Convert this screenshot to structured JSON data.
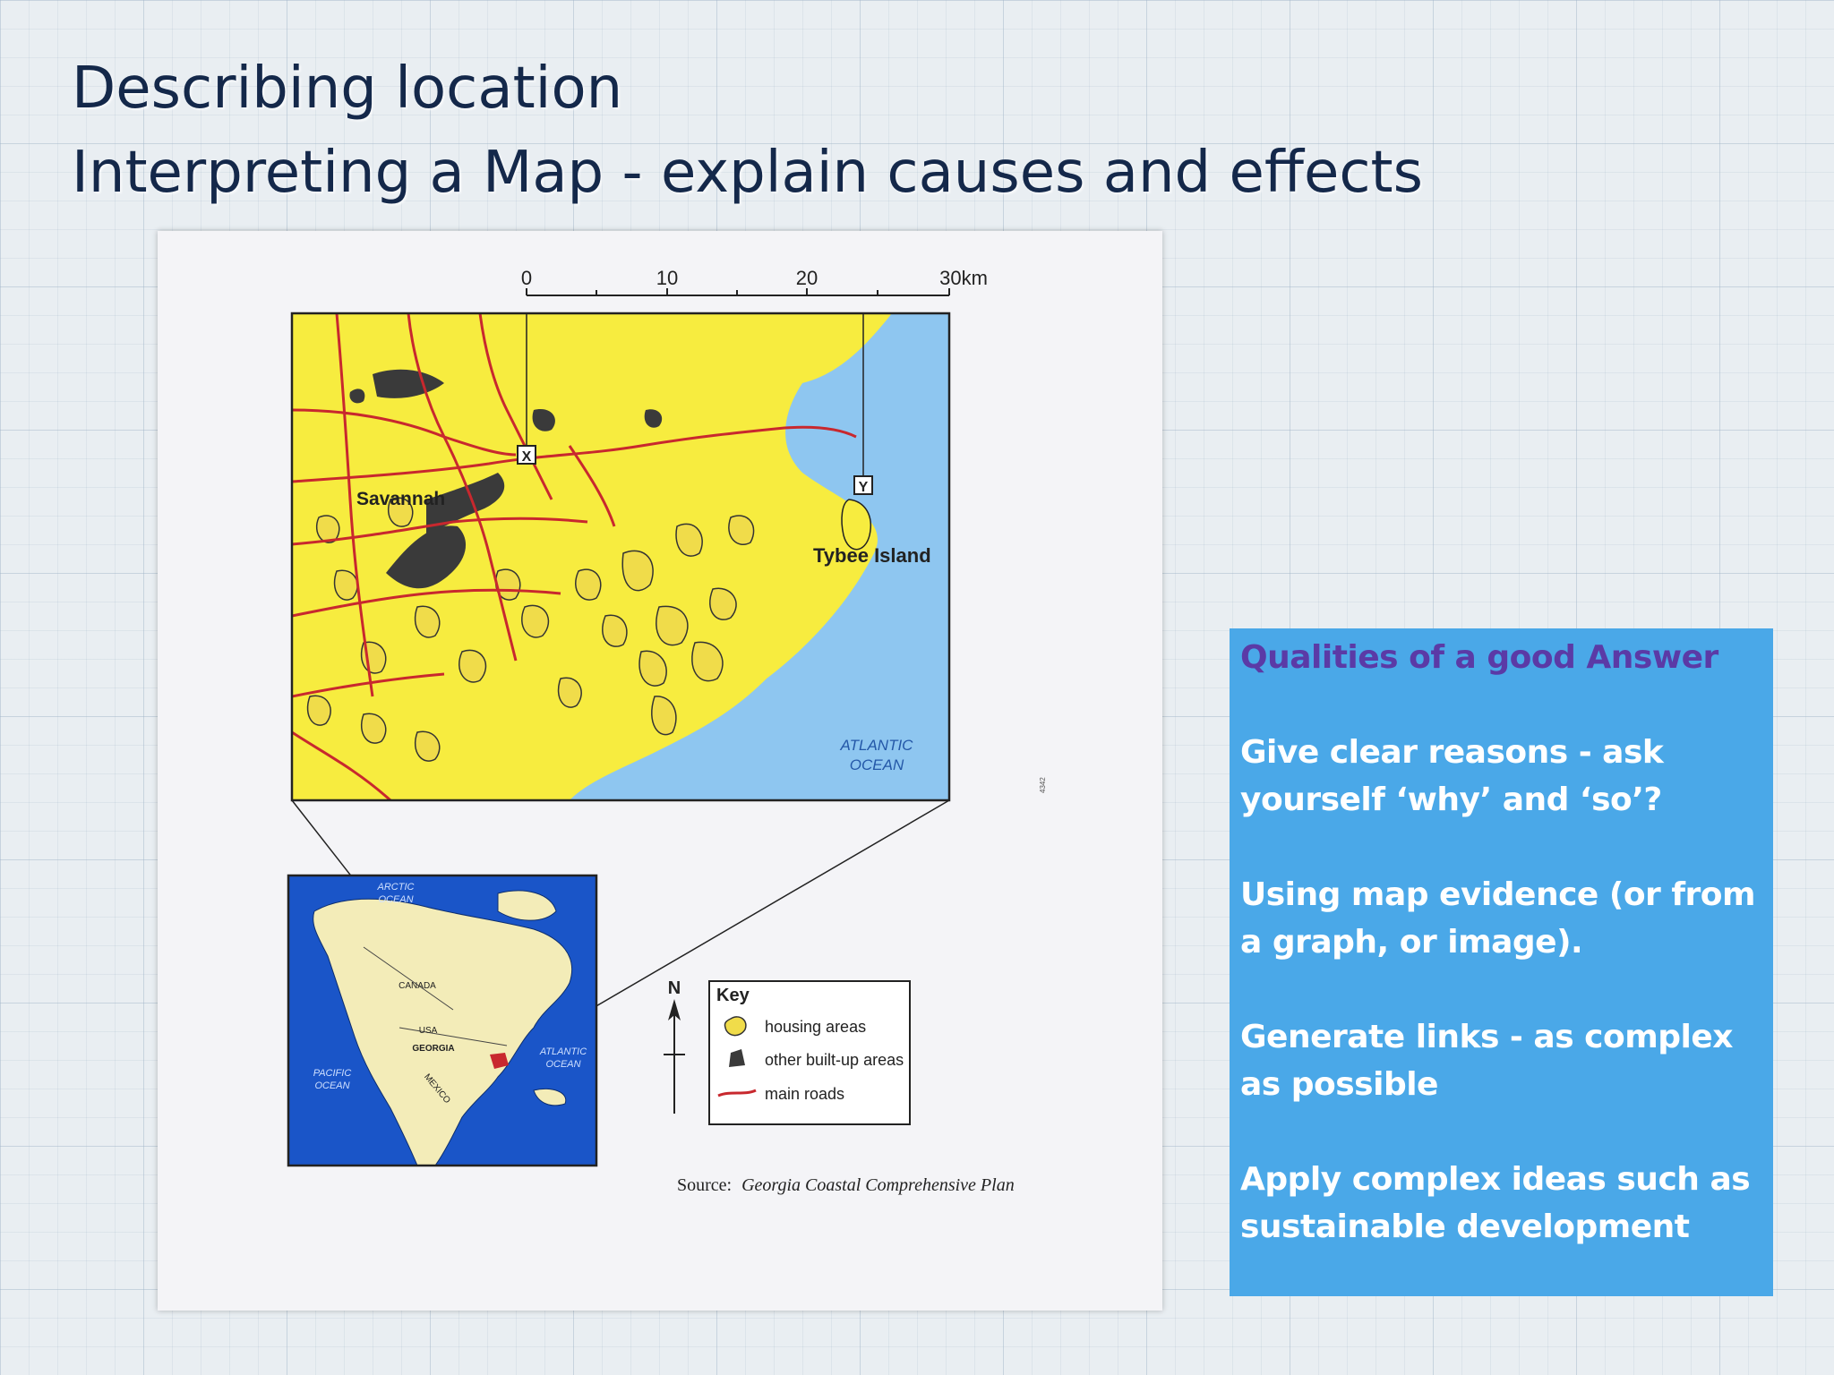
{
  "title": {
    "line1": "Describing location",
    "line2": "Interpreting a Map - explain causes and effects"
  },
  "map": {
    "scale": {
      "ticks": [
        "0",
        "10",
        "20",
        "30km"
      ]
    },
    "place_labels": {
      "savannah": "Savannah",
      "tybee": "Tybee Island",
      "atlantic_1": "ATLANTIC",
      "atlantic_2": "OCEAN",
      "x_marker": "X",
      "y_marker": "Y"
    },
    "inset_labels": {
      "arctic_1": "ARCTIC",
      "arctic_2": "OCEAN",
      "canada": "CANADA",
      "usa": "USA",
      "georgia": "GEORGIA",
      "mexico": "MEXICO",
      "pacific_1": "PACIFIC",
      "pacific_2": "OCEAN",
      "atlantic_1": "ATLANTIC",
      "atlantic_2": "OCEAN"
    },
    "north": "N",
    "key": {
      "title": "Key",
      "items": [
        "housing areas",
        "other built-up areas",
        "main roads"
      ]
    },
    "source_label": "Source:",
    "source_title": "Georgia Coastal Comprehensive Plan",
    "side_code": "4342",
    "colors": {
      "land": "#f7ec3f",
      "sea": "#8ec6f0",
      "housing": "#f0dc4a",
      "built_up": "#3a3a3a",
      "roads": "#c8282e",
      "inset_sea": "#1a55c8",
      "inset_land": "#f3ecb8"
    }
  },
  "panel": {
    "heading": "Qualities of a good Answer",
    "points": [
      "Give clear reasons - ask yourself ‘why’ and ‘so’?",
      "Using map evidence (or from a graph, or image).",
      "Generate links - as complex as possible",
      "Apply complex ideas such as sustainable development"
    ]
  }
}
